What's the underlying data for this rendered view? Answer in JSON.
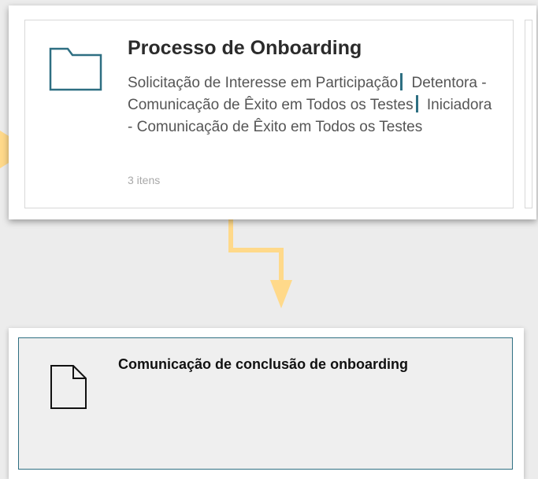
{
  "folder_card": {
    "title": "Processo de Onboarding",
    "items": [
      "Solicitação de Interesse em Participação",
      "Detentora - Comunicação de Êxito em Todos os Testes",
      "Iniciadora - Comunicação de Êxito em Todos os Testes"
    ],
    "count": "3 itens",
    "icon": "folder-icon",
    "separator_color": "#2e6f82"
  },
  "doc_card": {
    "title": "Comunicação de conclusão de onboarding",
    "icon": "document-icon",
    "border_color": "#2e6f82"
  },
  "colors": {
    "arrow": "#ffd98a",
    "background": "#ececec"
  }
}
